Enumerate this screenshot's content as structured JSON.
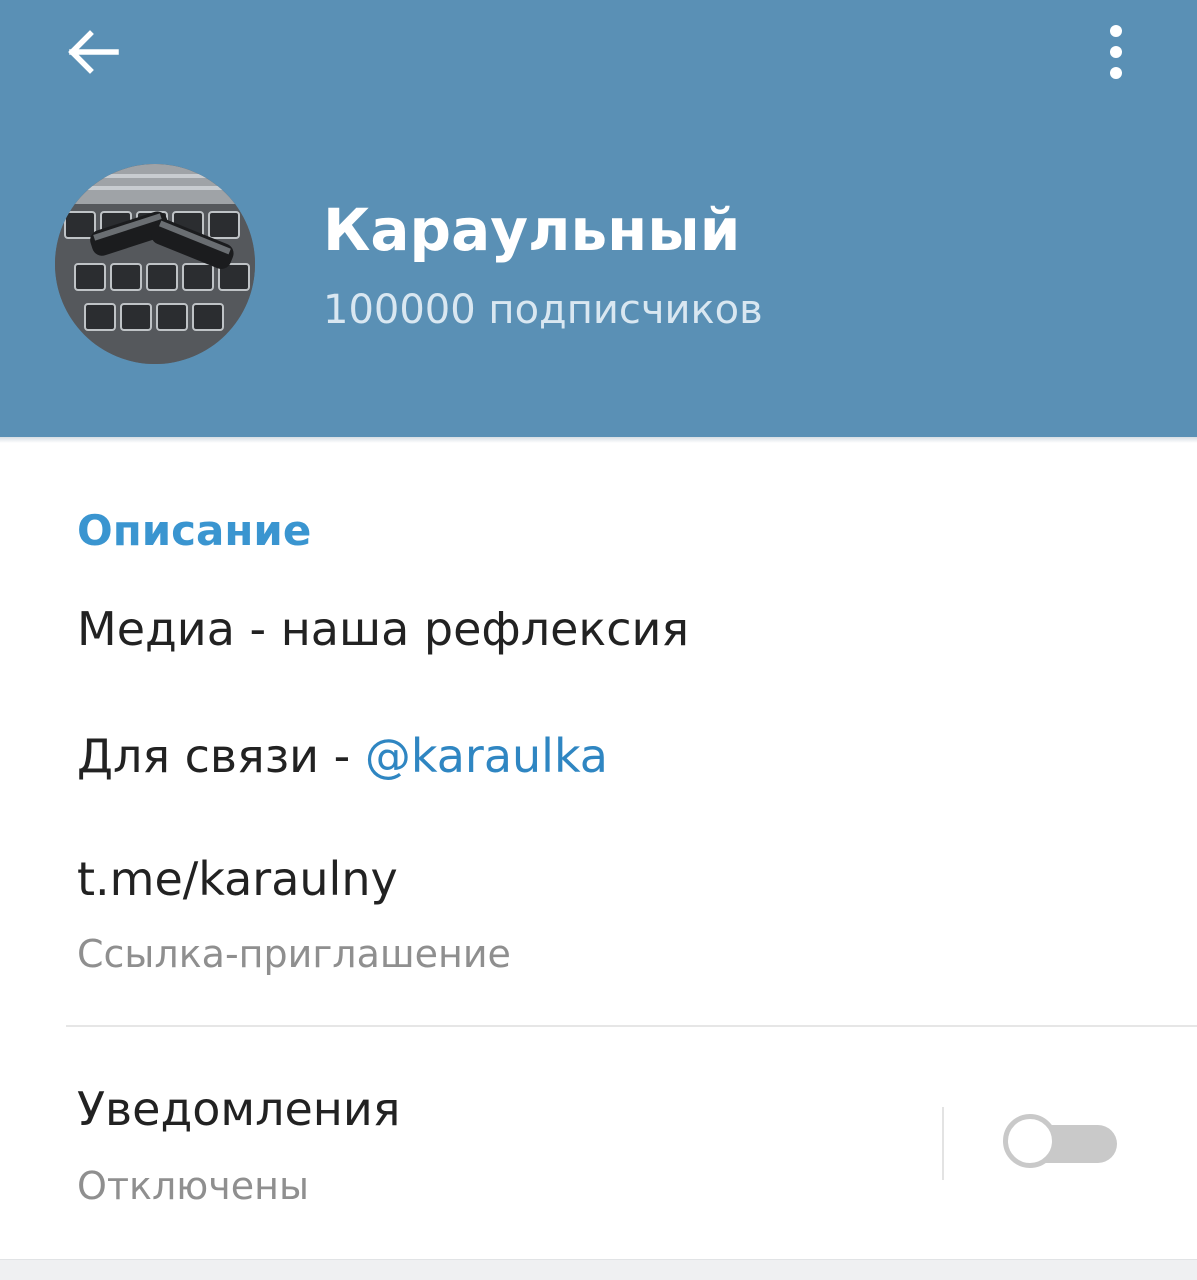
{
  "header": {
    "channel_name": "Караульный",
    "subscribers": "100000 подписчиков",
    "back_icon": "arrow-left-icon",
    "menu_icon": "more-vertical-icon"
  },
  "description": {
    "title": "Описание",
    "line1": "Медиа - наша рефлексия",
    "line2_prefix": "Для связи - ",
    "line2_mention": "@karaulka"
  },
  "invite_link": {
    "value": "t.me/karaulny",
    "caption": "Ссылка-приглашение"
  },
  "notifications": {
    "title": "Уведомления",
    "status": "Отключены",
    "enabled": false
  },
  "colors": {
    "header_bg": "#5a90b5",
    "accent": "#3a95d0",
    "link": "#2f86c2"
  }
}
